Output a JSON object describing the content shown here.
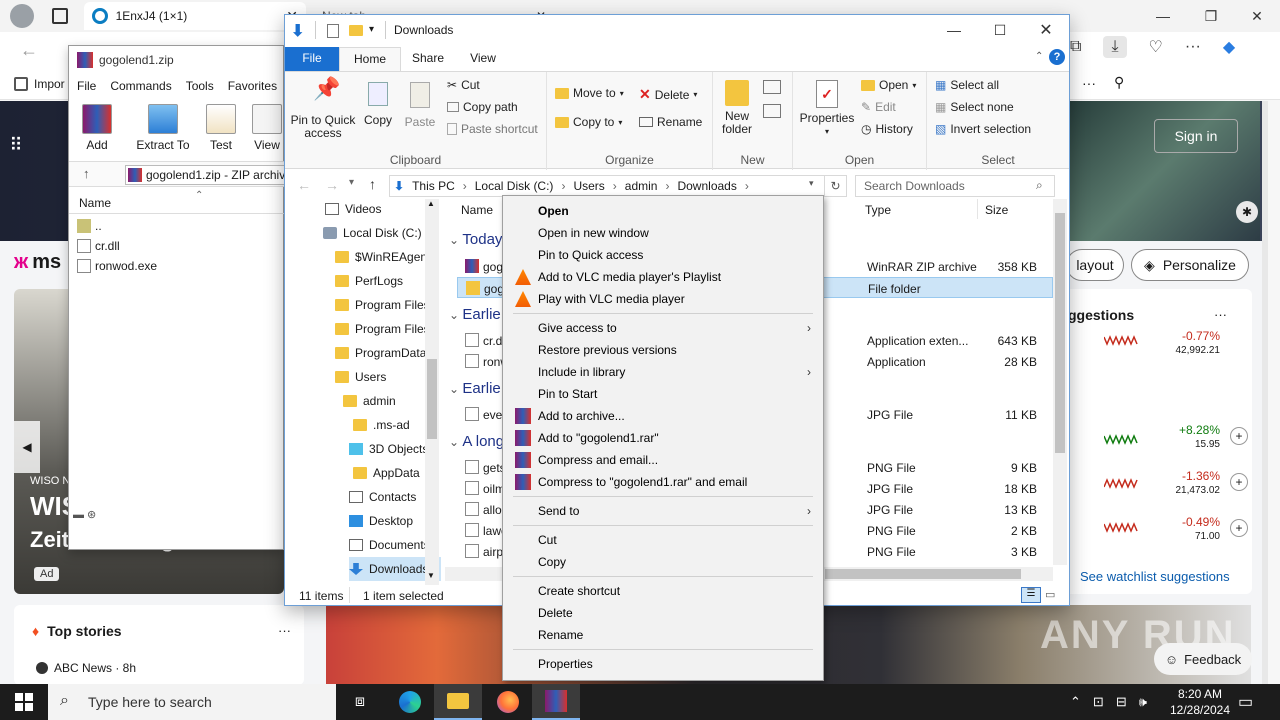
{
  "edge": {
    "tab1_title": "1EnxJ4 (1×1)",
    "tab2_title": "New tab",
    "fav_item": "Impor",
    "signin": "Sign in",
    "layout_btn": "layout",
    "personalize_btn": "Personalize",
    "suggestions_title": "ggestions",
    "more_dots": "···",
    "stocks": [
      {
        "change": "-0.77%",
        "value": "42,992.21",
        "color": "#c42b1c"
      },
      {
        "change": "+8.28%",
        "value": "15.95",
        "color": "#107c10"
      },
      {
        "change": "-1.36%",
        "value": "21,473.02",
        "color": "#c42b1c"
      },
      {
        "change": "-0.49%",
        "value": "71.00",
        "color": "#c42b1c"
      }
    ],
    "watchlist_link": "See watchlist suggestions",
    "feedback": "Feedback",
    "msn_logo": "ms",
    "ad_source": "WISO N",
    "ad_title_big": "WIS",
    "ad_subtitle": "Zeiterfassung & Vorber",
    "ad_badge": "Ad",
    "top_stories": "Top stories",
    "news_source": "ABC News · 8h",
    "watermark": "ANY RUN"
  },
  "winrar": {
    "title": "gogolend1.zip",
    "menu": [
      "File",
      "Commands",
      "Tools",
      "Favorites"
    ],
    "tools": [
      "Add",
      "Extract To",
      "Test",
      "View"
    ],
    "path": "gogolend1.zip - ZIP archiv",
    "col_name": "Name",
    "files": [
      "..",
      "cr.dll",
      "ronwod.exe"
    ]
  },
  "explorer": {
    "title": "Downloads",
    "tabs": [
      "File",
      "Home",
      "Share",
      "View"
    ],
    "clipboard": {
      "pin": "Pin to Quick access",
      "copy": "Copy",
      "paste": "Paste",
      "cut": "Cut",
      "copy_path": "Copy path",
      "paste_shortcut": "Paste shortcut",
      "group": "Clipboard"
    },
    "organize": {
      "move_to": "Move to",
      "copy_to": "Copy to",
      "delete": "Delete",
      "rename": "Rename",
      "group": "Organize"
    },
    "new": {
      "new_folder": "New folder",
      "group": "New"
    },
    "open": {
      "properties": "Properties",
      "open": "Open",
      "edit": "Edit",
      "history": "History",
      "group": "Open"
    },
    "select": {
      "all": "Select all",
      "none": "Select none",
      "invert": "Invert selection",
      "group": "Select"
    },
    "breadcrumb": [
      "This PC",
      "Local Disk (C:)",
      "Users",
      "admin",
      "Downloads"
    ],
    "search_placeholder": "Search Downloads",
    "nav": [
      "Videos",
      "Local Disk (C:)",
      "$WinREAgent",
      "PerfLogs",
      "Program Files",
      "Program Files",
      "ProgramData",
      "Users",
      "admin",
      ".ms-ad",
      "3D Objects",
      "AppData",
      "Contacts",
      "Desktop",
      "Documents",
      "Downloads"
    ],
    "columns": {
      "name": "Name",
      "type": "Type",
      "size": "Size"
    },
    "groups": [
      "Today",
      "Earlie",
      "Earlie",
      "A long"
    ],
    "files": [
      {
        "name": "gog",
        "date": "",
        "type": "WinRAR ZIP archive",
        "size": "358 KB"
      },
      {
        "name": "gog",
        "date": "",
        "type": "File folder",
        "size": ""
      },
      {
        "name": "cr.d",
        "date": "",
        "type": "Application exten...",
        "size": "643 KB"
      },
      {
        "name": "ronw",
        "date": "",
        "type": "Application",
        "size": "28 KB"
      },
      {
        "name": "ever",
        "date": "",
        "type": "JPG File",
        "size": "11 KB"
      },
      {
        "name": "gets",
        "date": "M",
        "type": "PNG File",
        "size": "9 KB"
      },
      {
        "name": "oilm",
        "date": "",
        "type": "JPG File",
        "size": "18 KB"
      },
      {
        "name": "allo",
        "date": "M",
        "type": "JPG File",
        "size": "13 KB"
      },
      {
        "name": "lawe",
        "date": "",
        "type": "PNG File",
        "size": "2 KB"
      },
      {
        "name": "airp",
        "date": "",
        "type": "PNG File",
        "size": "3 KB"
      }
    ],
    "status_items": "11 items",
    "status_selected": "1 item selected"
  },
  "context_menu": [
    {
      "label": "Open",
      "bold": true,
      "icon": ""
    },
    {
      "label": "Open in new window",
      "icon": ""
    },
    {
      "label": "Pin to Quick access",
      "icon": ""
    },
    {
      "label": "Add to VLC media player's Playlist",
      "icon": "vlc"
    },
    {
      "label": "Play with VLC media player",
      "icon": "vlc"
    },
    {
      "sep": true
    },
    {
      "label": "Give access to",
      "submenu": true,
      "icon": ""
    },
    {
      "label": "Restore previous versions",
      "icon": ""
    },
    {
      "label": "Include in library",
      "submenu": true,
      "icon": ""
    },
    {
      "label": "Pin to Start",
      "icon": ""
    },
    {
      "label": "Add to archive...",
      "icon": "rar"
    },
    {
      "label": "Add to \"gogolend1.rar\"",
      "icon": "rar"
    },
    {
      "label": "Compress and email...",
      "icon": "rar"
    },
    {
      "label": "Compress to \"gogolend1.rar\" and email",
      "icon": "rar"
    },
    {
      "sep": true
    },
    {
      "label": "Send to",
      "submenu": true,
      "icon": ""
    },
    {
      "sep": true
    },
    {
      "label": "Cut",
      "icon": ""
    },
    {
      "label": "Copy",
      "icon": ""
    },
    {
      "sep": true
    },
    {
      "label": "Create shortcut",
      "icon": ""
    },
    {
      "label": "Delete",
      "icon": ""
    },
    {
      "label": "Rename",
      "icon": ""
    },
    {
      "sep": true
    },
    {
      "label": "Properties",
      "icon": ""
    }
  ],
  "taskbar": {
    "search_placeholder": "Type here to search",
    "time": "8:20 AM",
    "date": "12/28/2024"
  }
}
